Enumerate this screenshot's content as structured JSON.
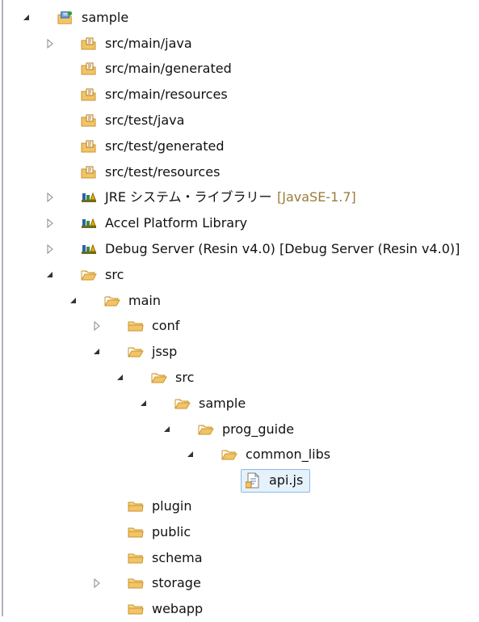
{
  "tree": [
    {
      "label": "sample",
      "icon": "project-icon",
      "twisty": "expanded"
    },
    {
      "label": "src/main/java",
      "icon": "source-folder-icon",
      "twisty": "collapsed"
    },
    {
      "label": "src/main/generated",
      "icon": "source-folder-icon",
      "twisty": "none"
    },
    {
      "label": "src/main/resources",
      "icon": "source-folder-icon",
      "twisty": "none"
    },
    {
      "label": "src/test/java",
      "icon": "source-folder-icon",
      "twisty": "none"
    },
    {
      "label": "src/test/generated",
      "icon": "source-folder-icon",
      "twisty": "none"
    },
    {
      "label": "src/test/resources",
      "icon": "source-folder-icon",
      "twisty": "none"
    },
    {
      "label": "JRE システム・ライブラリー",
      "decoration": "[JavaSE-1.7]",
      "icon": "library-icon",
      "twisty": "collapsed"
    },
    {
      "label": "Accel Platform Library",
      "icon": "library-icon",
      "twisty": "collapsed"
    },
    {
      "label": "Debug Server (Resin v4.0) [Debug Server (Resin v4.0)]",
      "icon": "library-icon",
      "twisty": "collapsed"
    },
    {
      "label": "src",
      "icon": "folder-open-icon",
      "twisty": "expanded"
    },
    {
      "label": "main",
      "icon": "folder-open-icon",
      "twisty": "expanded"
    },
    {
      "label": "conf",
      "icon": "folder-icon",
      "twisty": "collapsed"
    },
    {
      "label": "jssp",
      "icon": "folder-open-icon",
      "twisty": "expanded"
    },
    {
      "label": "src",
      "icon": "folder-open-icon",
      "twisty": "expanded"
    },
    {
      "label": "sample",
      "icon": "folder-open-icon",
      "twisty": "expanded"
    },
    {
      "label": "prog_guide",
      "icon": "folder-open-icon",
      "twisty": "expanded"
    },
    {
      "label": "common_libs",
      "icon": "folder-open-icon",
      "twisty": "expanded"
    },
    {
      "label": "api.js",
      "icon": "js-file-icon",
      "twisty": "none",
      "selected": true
    },
    {
      "label": "plugin",
      "icon": "folder-icon",
      "twisty": "none"
    },
    {
      "label": "public",
      "icon": "folder-icon",
      "twisty": "none"
    },
    {
      "label": "schema",
      "icon": "folder-icon",
      "twisty": "none"
    },
    {
      "label": "storage",
      "icon": "folder-icon",
      "twisty": "collapsed"
    },
    {
      "label": "webapp",
      "icon": "folder-icon",
      "twisty": "none"
    }
  ],
  "colors": {
    "folder": "#f2c466",
    "folder_stroke": "#c9952e",
    "library_books": "#2f5fb0",
    "decoration": "#9a7d3a",
    "selection_fill": "#e5f1fb",
    "selection_border": "#8fb8e4"
  }
}
